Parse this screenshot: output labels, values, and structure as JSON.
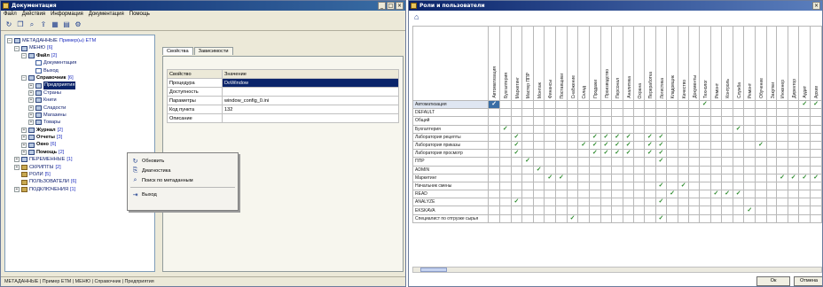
{
  "left_window": {
    "title": "Документация",
    "controls": [
      "_",
      "□",
      "×"
    ],
    "menu": [
      "Файл",
      "Действия",
      "Информация",
      "Документация",
      "Помощь"
    ],
    "toolbar_icons": [
      "refresh-icon",
      "new-document-icon",
      "search-icon",
      "export-icon",
      "grid-icon",
      "tree-icon",
      "settings-icon"
    ],
    "toolbar_glyphs": [
      "↻",
      "❐",
      "⌕",
      "⇪",
      "▦",
      "▤",
      "⚙"
    ],
    "tree": [
      {
        "depth": 0,
        "exp": "−",
        "icon": "grid",
        "label": "МЕТАДАННЫЕ",
        "count": "Пример(ы) ETM",
        "bold": false
      },
      {
        "depth": 1,
        "exp": "−",
        "icon": "grid",
        "label": "МЕНЮ",
        "count": "[6]",
        "bold": false
      },
      {
        "depth": 2,
        "exp": "−",
        "icon": "grid",
        "label": "Файл",
        "count": "[2]",
        "bold": true
      },
      {
        "depth": 3,
        "exp": "",
        "icon": "doc",
        "label": "Документация",
        "count": "",
        "bold": false
      },
      {
        "depth": 3,
        "exp": "",
        "icon": "doc",
        "label": "Выход",
        "count": "",
        "bold": false
      },
      {
        "depth": 2,
        "exp": "−",
        "icon": "grid",
        "label": "Справочник",
        "count": "[6]",
        "bold": true
      },
      {
        "depth": 3,
        "exp": "+",
        "icon": "grid",
        "label": "Предприятия",
        "count": "",
        "bold": false,
        "selected": true
      },
      {
        "depth": 3,
        "exp": "+",
        "icon": "grid",
        "label": "Страны",
        "count": "",
        "bold": false
      },
      {
        "depth": 3,
        "exp": "+",
        "icon": "grid",
        "label": "Книги",
        "count": "",
        "bold": false
      },
      {
        "depth": 3,
        "exp": "+",
        "icon": "grid",
        "label": "Сладости",
        "count": "",
        "bold": false
      },
      {
        "depth": 3,
        "exp": "+",
        "icon": "grid",
        "label": "Магазины",
        "count": "",
        "bold": false
      },
      {
        "depth": 3,
        "exp": "+",
        "icon": "grid",
        "label": "Товары",
        "count": "",
        "bold": false
      },
      {
        "depth": 2,
        "exp": "+",
        "icon": "grid",
        "label": "Журнал",
        "count": "[2]",
        "bold": true
      },
      {
        "depth": 2,
        "exp": "+",
        "icon": "grid",
        "label": "Отчеты",
        "count": "[3]",
        "bold": true
      },
      {
        "depth": 2,
        "exp": "+",
        "icon": "grid",
        "label": "Окно",
        "count": "[6]",
        "bold": true
      },
      {
        "depth": 2,
        "exp": "+",
        "icon": "grid",
        "label": "Помощь",
        "count": "[2]",
        "bold": true
      },
      {
        "depth": 1,
        "exp": "+",
        "icon": "grid",
        "label": "ПЕРЕМЕННЫЕ",
        "count": "[1]",
        "bold": false
      },
      {
        "depth": 1,
        "exp": "+",
        "icon": "folder",
        "label": "СКРИПТЫ",
        "count": "[2]",
        "bold": false
      },
      {
        "depth": 1,
        "exp": "",
        "icon": "folder",
        "label": "РОЛИ",
        "count": "[5]",
        "bold": false
      },
      {
        "depth": 1,
        "exp": "",
        "icon": "folder",
        "label": "ПОЛЬЗОВАТЕЛИ",
        "count": "[6]",
        "bold": false
      },
      {
        "depth": 1,
        "exp": "+",
        "icon": "folder",
        "label": "ПОДКЛЮЧЕНИЯ",
        "count": "[1]",
        "bold": false
      }
    ],
    "tabs": [
      "Свойства",
      "Зависимости"
    ],
    "properties": {
      "headers": [
        "Свойство",
        "Значение"
      ],
      "rows": [
        [
          "Процедура",
          "DoWindow"
        ],
        [
          "Доступность",
          ""
        ],
        [
          "Параметры",
          "window_config_0.ini"
        ],
        [
          "Код пункта",
          "132"
        ],
        [
          "Описание",
          ""
        ]
      ],
      "selected_row": 0
    },
    "context_menu": [
      {
        "icon": "refresh-icon",
        "glyph": "↻",
        "label": "Обновить"
      },
      {
        "icon": "diagnostics-icon",
        "glyph": "⎘",
        "label": "Диагностика"
      },
      {
        "icon": "binoculars-icon",
        "glyph": "⌕",
        "label": "Поиск по метаданным"
      },
      {
        "icon": "exit-icon",
        "glyph": "⇥",
        "label": "Выход",
        "separator_before": true
      }
    ],
    "statusbar": "МЕТАДАННЫЕ | Пример ETM | МЕНЮ | Справочник | Предприятия"
  },
  "right_window": {
    "title": "Роли и пользователи",
    "controls": [
      "×"
    ],
    "toolbar_glyph": "⌂",
    "columns": [
      "Автоматизация",
      "Бухгалтерия",
      "Маркетинг",
      "Мастер ППР",
      "Монтаж",
      "Финансы",
      "Поставщики",
      "Снабжение",
      "Склад",
      "Продажи",
      "Производство",
      "Персонал",
      "Аналитика",
      "Охрана",
      "Переработка",
      "Логистика",
      "Кладовщик",
      "Качество",
      "Документы",
      "Технолог",
      "Ремонт",
      "Контроль",
      "Служба",
      "Ремонт",
      "Обучение",
      "Закупки",
      "Инженер",
      "Директор",
      "Аудит",
      "Архив"
    ],
    "rows": [
      {
        "label": "Автоматизация",
        "checks": [
          0,
          19,
          28,
          29
        ]
      },
      {
        "label": "DEFAULT",
        "checks": []
      },
      {
        "label": "Общий",
        "checks": []
      },
      {
        "label": "Бухгалтерия",
        "checks": [
          1,
          22
        ]
      },
      {
        "label": "Лаборатория рецепты",
        "checks": [
          2,
          9,
          10,
          11,
          12,
          14,
          15
        ]
      },
      {
        "label": "Лаборатория приказы",
        "checks": [
          2,
          8,
          9,
          10,
          11,
          12,
          14,
          15,
          24
        ]
      },
      {
        "label": "Лаборатория просмотр",
        "checks": [
          2,
          9,
          10,
          11,
          12,
          14,
          15
        ]
      },
      {
        "label": "ППР",
        "checks": [
          3,
          15
        ]
      },
      {
        "label": "ADMIN",
        "checks": [
          4
        ]
      },
      {
        "label": "Маркетинг",
        "checks": [
          5,
          6,
          26,
          27,
          28,
          29
        ]
      },
      {
        "label": "Начальник смены",
        "checks": [
          15,
          17
        ]
      },
      {
        "label": "READ",
        "checks": [
          16,
          20,
          21,
          22
        ]
      },
      {
        "label": "ANALYZE",
        "checks": [
          2,
          15
        ]
      },
      {
        "label": "EKSKAVA",
        "checks": [
          23
        ]
      },
      {
        "label": "Специалист по отгрузке сырья",
        "checks": [
          7,
          15
        ]
      }
    ],
    "selected_row": 0,
    "check_glyph": "✓",
    "ok_label": "Ок",
    "cancel_label": "Отмена"
  },
  "colors": {
    "title_bar": "#0a246a",
    "selection": "#0a246a",
    "check": "#2c8a2c",
    "window_bg": "#ece9d8"
  }
}
